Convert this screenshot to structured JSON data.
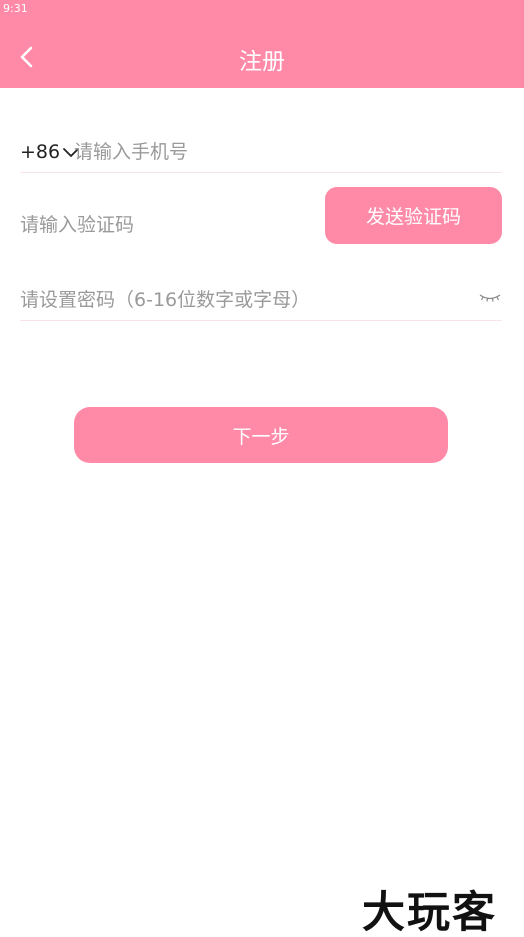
{
  "status_bar": {
    "time": "9:31"
  },
  "header": {
    "title": "注册"
  },
  "form": {
    "country_code": "+86",
    "phone_placeholder": "请输入手机号",
    "code_placeholder": "请输入验证码",
    "send_code_label": "发送验证码",
    "password_placeholder": "请设置密码（6-16位数字或字母）",
    "next_label": "下一步"
  },
  "watermark": {
    "text": "大玩客"
  },
  "colors": {
    "accent": "#ff8aa8",
    "divider": "#f7e3e8",
    "placeholder": "#9a9a9a"
  }
}
